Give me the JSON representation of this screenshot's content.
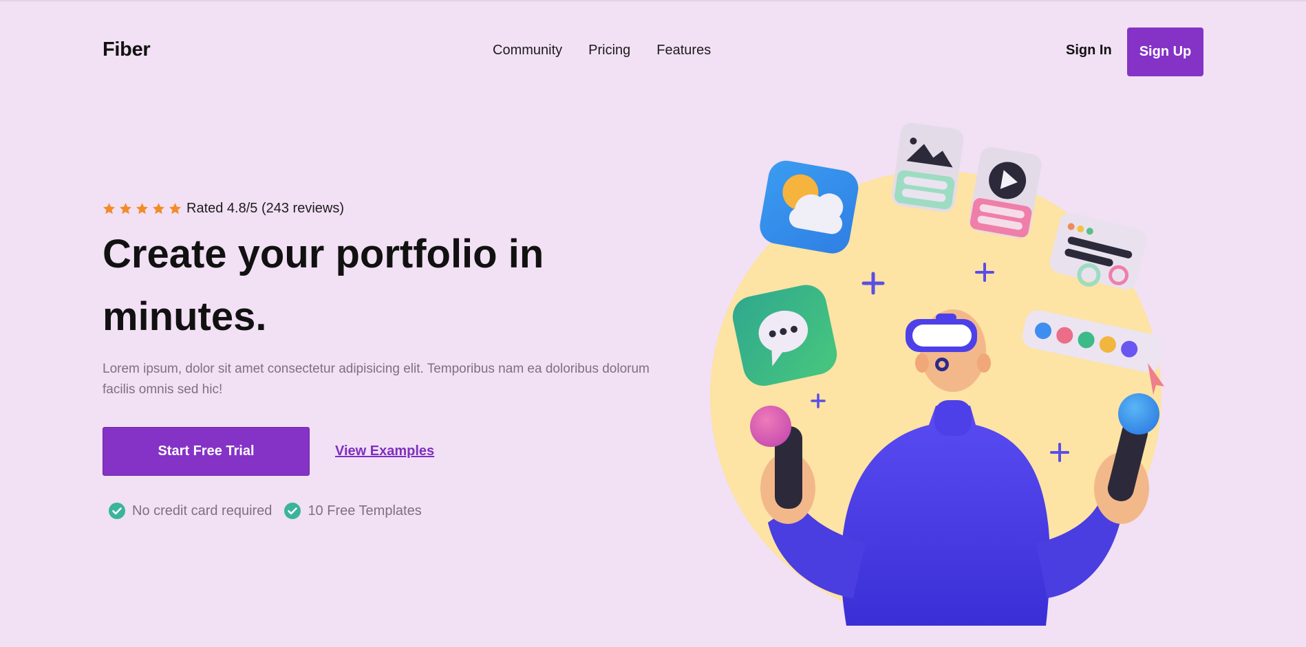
{
  "brand": {
    "name": "Fiber"
  },
  "nav": {
    "links": [
      "Community",
      "Pricing",
      "Features"
    ],
    "sign_in": "Sign In",
    "sign_up": "Sign Up"
  },
  "hero": {
    "rating": {
      "stars": 5,
      "text": "Rated 4.8/5 (243 reviews)"
    },
    "headline_line1": "Create your portfolio in",
    "headline_line2": "minutes.",
    "description": "Lorem ipsum, dolor sit amet consectetur adipisicing elit. Temporibus nam ea doloribus dolorum facilis omnis sed hic!",
    "primary_cta": "Start Free Trial",
    "secondary_cta": "View Examples",
    "perks": [
      "No credit card required",
      "10 Free Templates"
    ]
  },
  "colors": {
    "background": "#f2e0f4",
    "accent": "#8533c7",
    "star": "#f28c28",
    "check": "#3ab49a",
    "illustration_circle": "#fde3a4",
    "figure": "#4a3ee0"
  },
  "illustration": {
    "icons": [
      "weather-icon",
      "image-card-icon",
      "video-card-icon",
      "layout-card-icon",
      "chat-icon",
      "color-palette-icon",
      "cursor-icon",
      "plus-icon"
    ]
  }
}
